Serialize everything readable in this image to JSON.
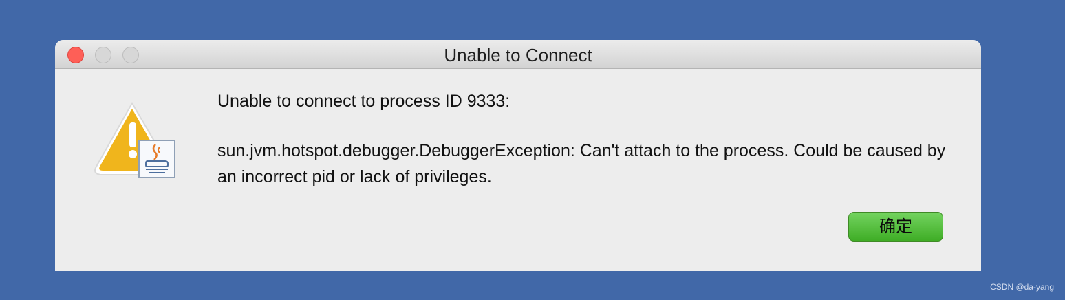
{
  "colors": {
    "desktop_background": "#4168a8",
    "dialog_background": "#ededed",
    "button_green": "#4bb630",
    "close_red": "#fe5f57"
  },
  "window": {
    "title": "Unable to Connect"
  },
  "icons": {
    "warning": "warning-icon",
    "java": "java-coffee-icon"
  },
  "message": {
    "line1": "Unable to connect to process ID 9333:",
    "line2": "sun.jvm.hotspot.debugger.DebuggerException: Can't attach to the process. Could be caused by an incorrect pid or lack of privileges."
  },
  "buttons": {
    "ok_label": "确定"
  },
  "watermark": "CSDN @da-yang"
}
